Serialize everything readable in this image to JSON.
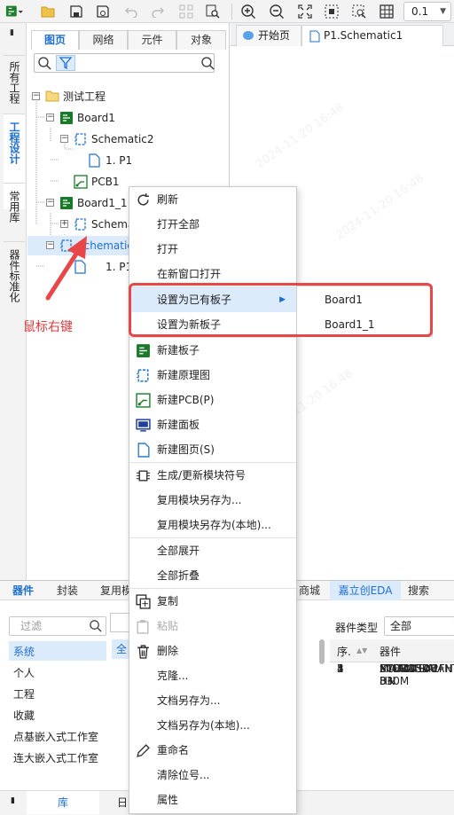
{
  "toolbar": {
    "zoom_value": "0.1",
    "icons": [
      "new-dropdown-icon",
      "open-folder-icon",
      "save-icon",
      "save-all-icon",
      "undo-icon",
      "redo-icon",
      "align-icon",
      "find-icon",
      "zoom-in-icon",
      "zoom-out-icon",
      "fit-icon",
      "zoom-area-icon",
      "zoom-selection-icon",
      "grid-icon"
    ]
  },
  "vertical_tabs": {
    "pin": "▮",
    "all_projects": "所有工程",
    "project_design": "工程设计",
    "common_library": "常用库",
    "component_standard": "器件标准化"
  },
  "panel": {
    "tabs": [
      "图页",
      "网络",
      "元件",
      "对象"
    ],
    "filter_icon": "filter-icon",
    "search_icon": "search-icon"
  },
  "tree": {
    "root": "测试工程",
    "board1": "Board1",
    "schematic2": "Schematic2",
    "p1a": "1. P1",
    "pcb1": "PCB1",
    "board1_1": "Board1_1",
    "schema_trunc": "Schema",
    "schematic_sel": "Schematic",
    "p1b": "1. P1"
  },
  "doc_tabs": {
    "start_page": "开始页",
    "schematic_tab": "P1.Schematic1"
  },
  "bottom": {
    "tabs": [
      "器件",
      "封装",
      "复用模",
      "商城",
      "嘉立创EDA",
      "搜索"
    ],
    "filter_placeholder": "过滤",
    "categories": [
      "系统",
      "个人",
      "工程",
      "收藏",
      "点基嵌入式工作室",
      "连大嵌入式工作室"
    ],
    "all_label": "全",
    "type_label": "器件类型",
    "type_value": "全部",
    "col_index": "序.",
    "col_device": "器件",
    "rows": [
      {
        "idx": "1",
        "name": "XCVU13P-2FH"
      },
      {
        "idx": "2",
        "name": "MICRO SIM 8+"
      },
      {
        "idx": "3",
        "name": "MAX40108ANT"
      },
      {
        "idx": "4",
        "name": "STHW4-DU-HN"
      },
      {
        "idx": "5",
        "name": "SCD1054-330M"
      }
    ],
    "left_tabs": [
      "库",
      "日"
    ]
  },
  "context_menu": {
    "refresh": "刷新",
    "open_all": "打开全部",
    "open": "打开",
    "open_new_window": "在新窗口打开",
    "set_existing_board": "设置为已有板子",
    "set_new_board": "设置为新板子",
    "new_board": "新建板子",
    "new_schematic": "新建原理图",
    "new_pcb": "新建PCB(P)",
    "new_panel": "新建面板",
    "new_page": "新建图页(S)",
    "gen_module": "生成/更新模块符号",
    "reuse_save_as": "复用模块另存为...",
    "reuse_save_as_local": "复用模块另存为(本地)...",
    "expand_all": "全部展开",
    "collapse_all": "全部折叠",
    "copy": "复制",
    "paste": "粘贴",
    "delete": "删除",
    "clone": "克隆...",
    "doc_save_as": "文档另存为...",
    "doc_save_as_local": "文档另存为(本地)...",
    "rename": "重命名",
    "clear_designator": "清除位号...",
    "properties": "属性"
  },
  "submenu": {
    "items": [
      "Board1",
      "Board1_1"
    ]
  },
  "annotation": {
    "text": "鼠标右键"
  },
  "colors": {
    "accent": "#1f6fd0",
    "highlight": "#dcebfb",
    "annotation": "#e8474a",
    "board_icon": "#1a7a2a"
  }
}
